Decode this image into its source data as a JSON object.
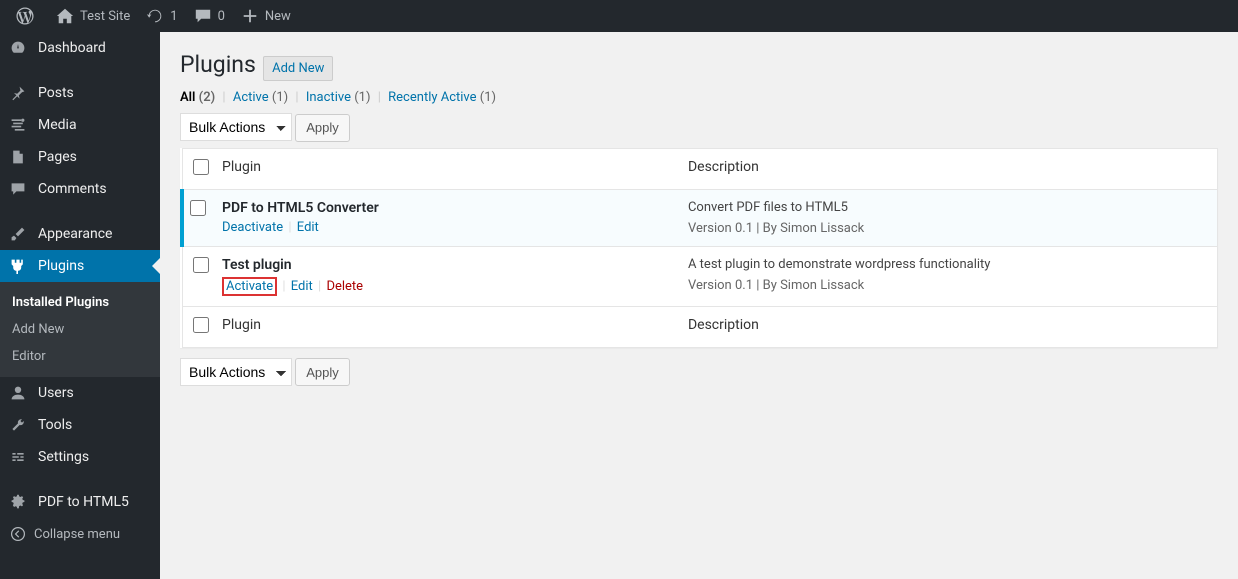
{
  "adminbar": {
    "site_name": "Test Site",
    "updates_count": "1",
    "comments_count": "0",
    "new_label": "New"
  },
  "sidebar": {
    "dashboard": "Dashboard",
    "posts": "Posts",
    "media": "Media",
    "pages": "Pages",
    "comments": "Comments",
    "appearance": "Appearance",
    "plugins": "Plugins",
    "submenu": {
      "installed": "Installed Plugins",
      "add_new": "Add New",
      "editor": "Editor"
    },
    "users": "Users",
    "tools": "Tools",
    "settings": "Settings",
    "pdf_to_html5": "PDF to HTML5",
    "collapse": "Collapse menu"
  },
  "page": {
    "title": "Plugins",
    "add_new": "Add New"
  },
  "filters": {
    "all_label": "All",
    "all_count": "(2)",
    "active_label": "Active",
    "active_count": "(1)",
    "inactive_label": "Inactive",
    "inactive_count": "(1)",
    "recent_label": "Recently Active",
    "recent_count": "(1)"
  },
  "bulk_select": "Bulk Actions",
  "apply_label": "Apply",
  "table": {
    "col_plugin": "Plugin",
    "col_desc": "Description",
    "rows": [
      {
        "name": "PDF to HTML5 Converter",
        "desc": "Convert PDF files to HTML5",
        "meta": "Version 0.1 | By Simon Lissack",
        "action1": "Deactivate",
        "action2": "Edit"
      },
      {
        "name": "Test plugin",
        "desc": "A test plugin to demonstrate wordpress functionality",
        "meta": "Version 0.1 | By Simon Lissack",
        "action1": "Activate",
        "action2": "Edit",
        "action3": "Delete"
      }
    ]
  }
}
